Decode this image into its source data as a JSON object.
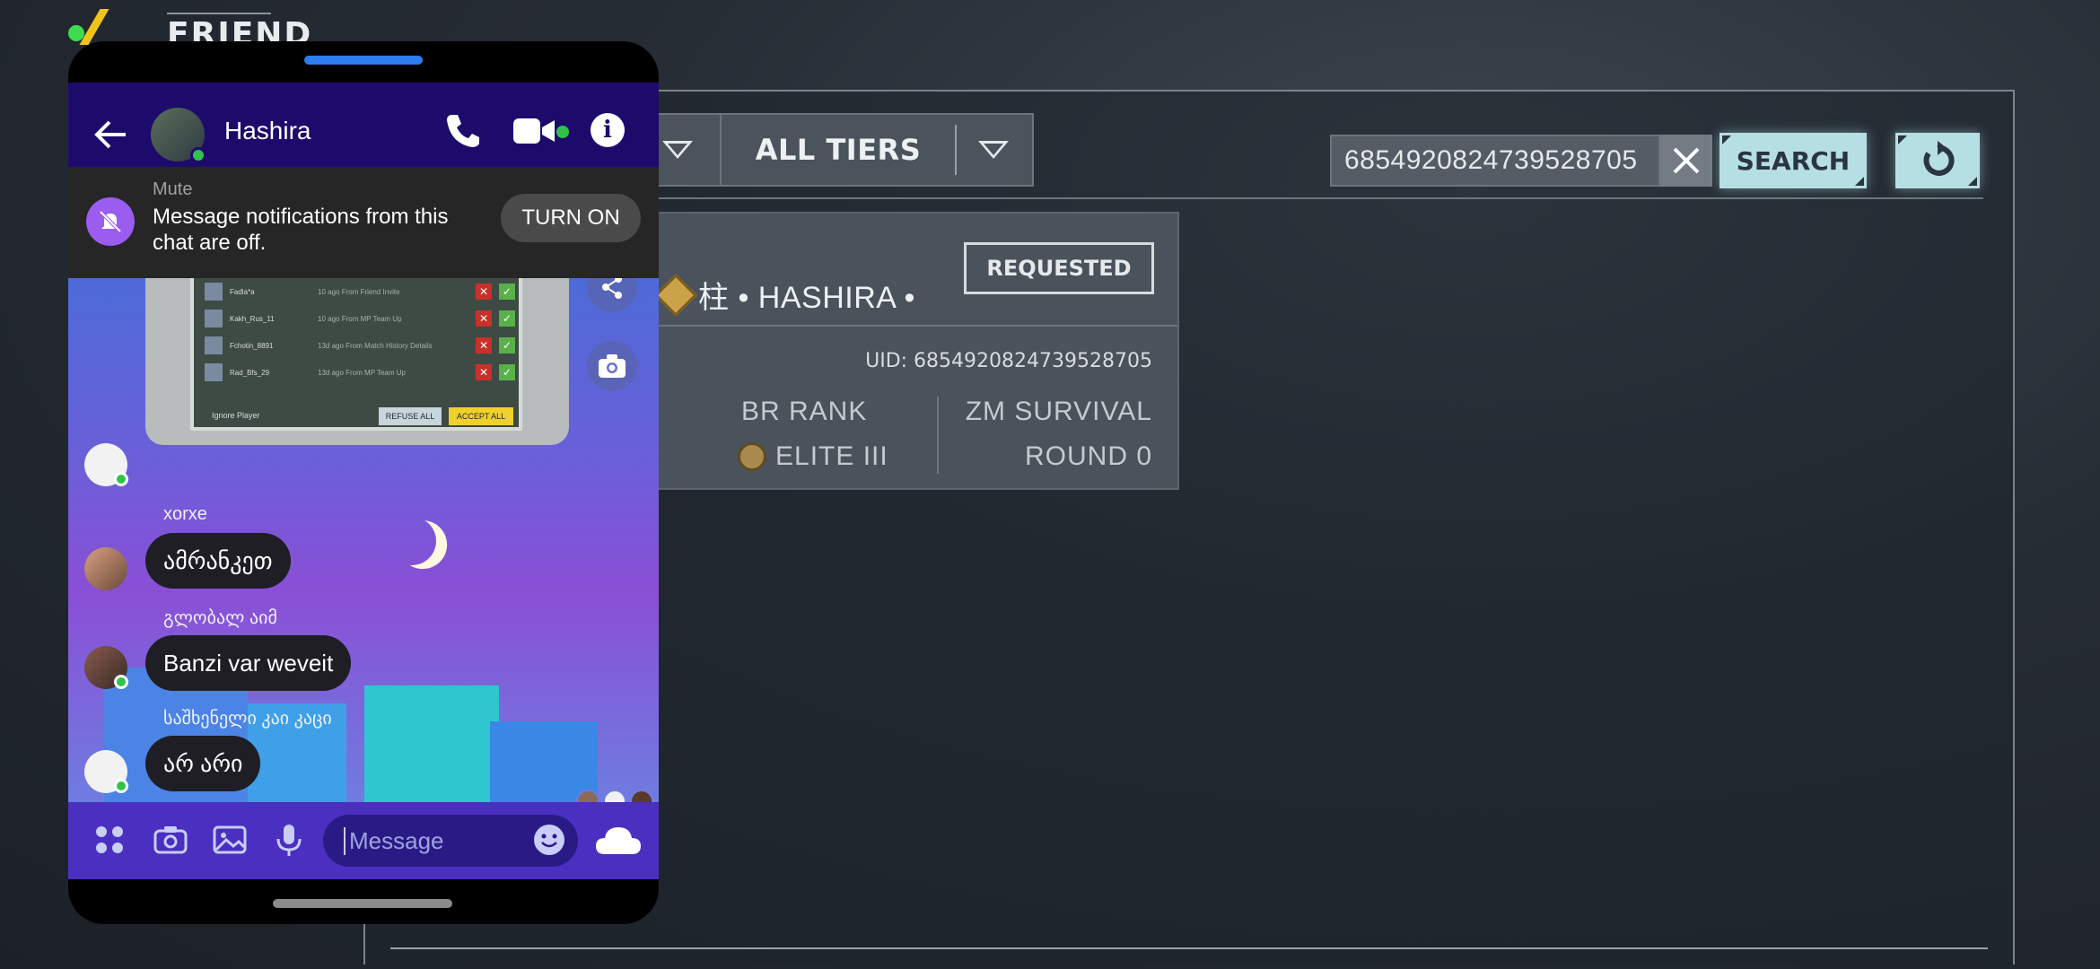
{
  "game": {
    "title": "FRIEND",
    "filters": {
      "tiers_label": "ALL TIERS"
    },
    "search": {
      "query": "6854920824739528705",
      "search_label": "SEARCH"
    },
    "result": {
      "player_name": "柱 • HASHIRA •",
      "request_status": "REQUESTED",
      "uid": "UID: 6854920824739528705",
      "br_rank_label": "BR RANK",
      "br_rank_value": "ELITE III",
      "zm_label": "ZM SURVIVAL",
      "zm_value": "ROUND 0"
    }
  },
  "messenger": {
    "contact_name": "Hashira",
    "mute": {
      "title": "Mute",
      "text": "Message notifications from this chat are off.",
      "button": "TURN ON"
    },
    "shared_screenshot": {
      "refuse_all": "REFUSE ALL",
      "accept_all": "ACCEPT ALL",
      "ignore_player": "Ignore Player",
      "rows": [
        {
          "name": "Fadla*a",
          "sub": "10 ago From Friend Invite"
        },
        {
          "name": "Kakh_Rus_11",
          "sub": "10 ago From MP Team Up"
        },
        {
          "name": "Fchotin_8891",
          "sub": "13d ago From Match History Details"
        },
        {
          "name": "Rad_Bfs_29",
          "sub": "13d ago From MP Team Up"
        }
      ]
    },
    "messages": [
      {
        "sender": "xorxe",
        "text": "ამრანკეთ"
      },
      {
        "sender": "გლობალ აიმ",
        "text": "Banzi var weveit"
      },
      {
        "sender": "საშხენელი კაი კაცი",
        "text": "არ არი"
      }
    ],
    "composer": {
      "placeholder": "Message"
    }
  },
  "colors": {
    "accent": "#b6dfe3",
    "messenger_header": "#1d0b6b",
    "composer": "#4a2fc0",
    "online": "#31c24a"
  }
}
